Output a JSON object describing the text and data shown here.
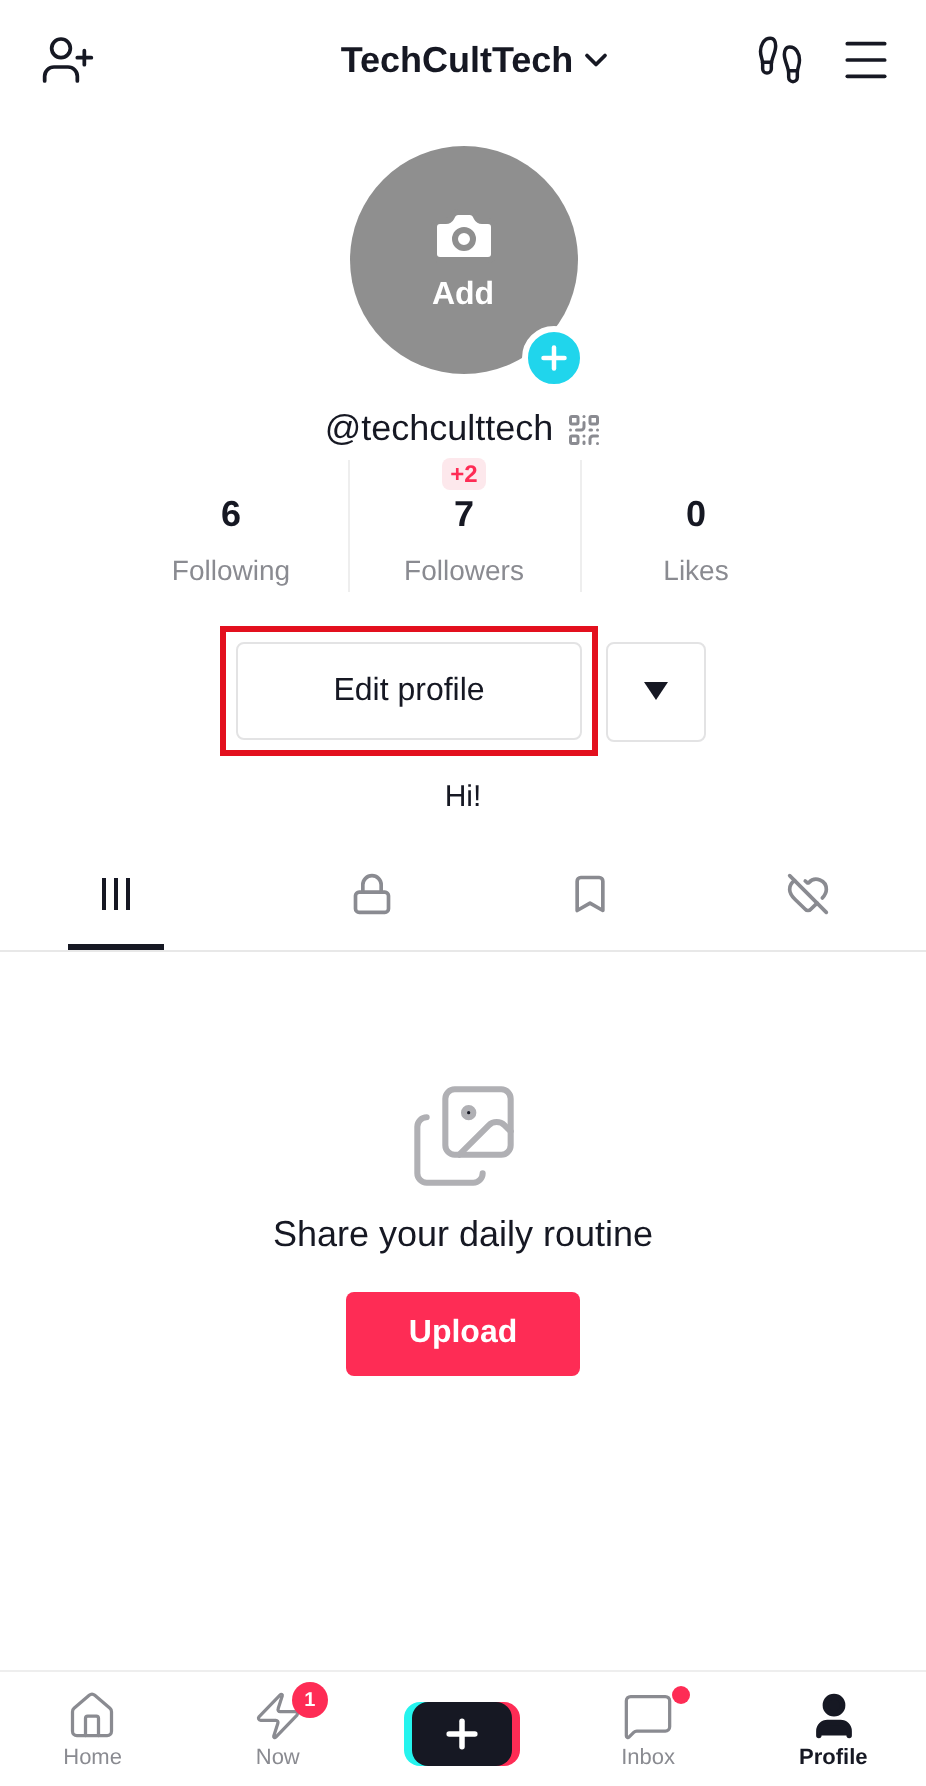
{
  "header": {
    "username": "TechCultTech"
  },
  "avatar": {
    "label": "Add"
  },
  "handle": "@techculttech",
  "stats": [
    {
      "value": "6",
      "label": "Following"
    },
    {
      "value": "7",
      "label": "Followers",
      "badge": "+2"
    },
    {
      "value": "0",
      "label": "Likes"
    }
  ],
  "edit_button": {
    "label": "Edit profile",
    "highlighted": true
  },
  "bio": "Hi!",
  "content_tabs": [
    {
      "kind": "videos",
      "selected": true
    },
    {
      "kind": "private",
      "selected": false
    },
    {
      "kind": "saved",
      "selected": false
    },
    {
      "kind": "liked",
      "selected": false
    }
  ],
  "empty_state": {
    "message": "Share your daily routine",
    "button": "Upload"
  },
  "bottom_nav": [
    {
      "kind": "home",
      "label": "Home",
      "selected": false
    },
    {
      "kind": "now",
      "label": "Now",
      "selected": false,
      "badge": "1"
    },
    {
      "kind": "create"
    },
    {
      "kind": "inbox",
      "label": "Inbox",
      "selected": false,
      "dot": true
    },
    {
      "kind": "profile",
      "label": "Profile",
      "selected": true
    }
  ]
}
